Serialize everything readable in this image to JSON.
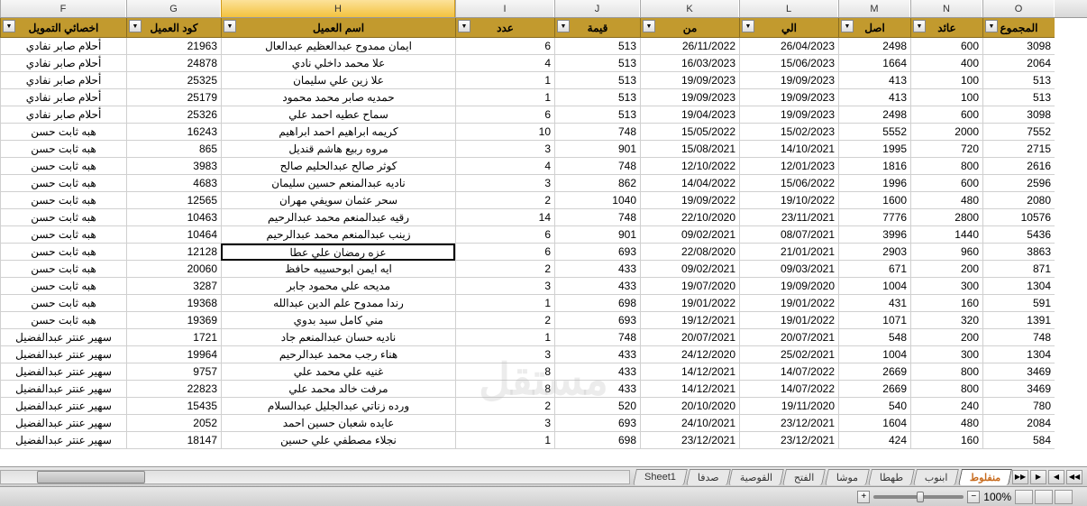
{
  "columns": [
    {
      "id": "F",
      "width": "c-F"
    },
    {
      "id": "G",
      "width": "c-G"
    },
    {
      "id": "H",
      "width": "c-H"
    },
    {
      "id": "I",
      "width": "c-I"
    },
    {
      "id": "J",
      "width": "c-J"
    },
    {
      "id": "K",
      "width": "c-K"
    },
    {
      "id": "L",
      "width": "c-L"
    },
    {
      "id": "M",
      "width": "c-M"
    },
    {
      "id": "N",
      "width": "c-N"
    },
    {
      "id": "O",
      "width": "c-O"
    }
  ],
  "selected_column": "H",
  "selected_row_index": 12,
  "headers": {
    "F": "اخصائي التمويل",
    "G": "كود العميل",
    "H": "اسم العميل",
    "I": "عدد",
    "J": "قيمة",
    "K": "من",
    "L": "الي",
    "M": "اصل",
    "N": "عائد",
    "O": "المجموع"
  },
  "rows": [
    {
      "F": "أحلام صابر نفادي",
      "G": "21963",
      "H": "ايمان ممدوح عبدالعظيم عبدالعال",
      "I": "6",
      "J": "513",
      "K": "26/11/2022",
      "L": "26/04/2023",
      "M": "2498",
      "N": "600",
      "O": "3098"
    },
    {
      "F": "أحلام صابر نفادي",
      "G": "24878",
      "H": "علا محمد داخلي نادي",
      "I": "4",
      "J": "513",
      "K": "16/03/2023",
      "L": "15/06/2023",
      "M": "1664",
      "N": "400",
      "O": "2064"
    },
    {
      "F": "أحلام صابر نفادي",
      "G": "25325",
      "H": "علا زين علي سليمان",
      "I": "1",
      "J": "513",
      "K": "19/09/2023",
      "L": "19/09/2023",
      "M": "413",
      "N": "100",
      "O": "513"
    },
    {
      "F": "أحلام صابر نفادي",
      "G": "25179",
      "H": "حمديه صابر محمد محمود",
      "I": "1",
      "J": "513",
      "K": "19/09/2023",
      "L": "19/09/2023",
      "M": "413",
      "N": "100",
      "O": "513"
    },
    {
      "F": "أحلام صابر نفادي",
      "G": "25326",
      "H": "سماح عطيه احمد علي",
      "I": "6",
      "J": "513",
      "K": "19/04/2023",
      "L": "19/09/2023",
      "M": "2498",
      "N": "600",
      "O": "3098"
    },
    {
      "F": "هبه ثابت حسن",
      "G": "16243",
      "H": "كريمه ابراهيم احمد ابراهيم",
      "I": "10",
      "J": "748",
      "K": "15/05/2022",
      "L": "15/02/2023",
      "M": "5552",
      "N": "2000",
      "O": "7552"
    },
    {
      "F": "هبه ثابت حسن",
      "G": "865",
      "H": "مروه ربيع هاشم قنديل",
      "I": "3",
      "J": "901",
      "K": "15/08/2021",
      "L": "14/10/2021",
      "M": "1995",
      "N": "720",
      "O": "2715"
    },
    {
      "F": "هبه ثابت حسن",
      "G": "3983",
      "H": "كوثر صالح عبدالحليم صالح",
      "I": "4",
      "J": "748",
      "K": "12/10/2022",
      "L": "12/01/2023",
      "M": "1816",
      "N": "800",
      "O": "2616"
    },
    {
      "F": "هبه ثابت حسن",
      "G": "4683",
      "H": "ناديه عبدالمنعم حسين سليمان",
      "I": "3",
      "J": "862",
      "K": "14/04/2022",
      "L": "15/06/2022",
      "M": "1996",
      "N": "600",
      "O": "2596"
    },
    {
      "F": "هبه ثابت حسن",
      "G": "12565",
      "H": "سحر عثمان سويفي مهران",
      "I": "2",
      "J": "1040",
      "K": "19/09/2022",
      "L": "19/10/2022",
      "M": "1600",
      "N": "480",
      "O": "2080"
    },
    {
      "F": "هبه ثابت حسن",
      "G": "10463",
      "H": "رقيه عبدالمنعم محمد عبدالرحيم",
      "I": "14",
      "J": "748",
      "K": "22/10/2020",
      "L": "23/11/2021",
      "M": "7776",
      "N": "2800",
      "O": "10576"
    },
    {
      "F": "هبه ثابت حسن",
      "G": "10464",
      "H": "زينب عبدالمنعم محمد عبدالرحيم",
      "I": "6",
      "J": "901",
      "K": "09/02/2021",
      "L": "08/07/2021",
      "M": "3996",
      "N": "1440",
      "O": "5436"
    },
    {
      "F": "هبه ثابت حسن",
      "G": "12128",
      "H": "عزه رمضان علي عطا",
      "I": "6",
      "J": "693",
      "K": "22/08/2020",
      "L": "21/01/2021",
      "M": "2903",
      "N": "960",
      "O": "3863"
    },
    {
      "F": "هبه ثابت حسن",
      "G": "20060",
      "H": "ايه ايمن ابوحسيبه حافظ",
      "I": "2",
      "J": "433",
      "K": "09/02/2021",
      "L": "09/03/2021",
      "M": "671",
      "N": "200",
      "O": "871"
    },
    {
      "F": "هبه ثابت حسن",
      "G": "3287",
      "H": "مديحه علي محمود جابر",
      "I": "3",
      "J": "433",
      "K": "19/07/2020",
      "L": "19/09/2020",
      "M": "1004",
      "N": "300",
      "O": "1304"
    },
    {
      "F": "هبه ثابت حسن",
      "G": "19368",
      "H": "رندا ممدوح علم الدين عبدالله",
      "I": "1",
      "J": "698",
      "K": "19/01/2022",
      "L": "19/01/2022",
      "M": "431",
      "N": "160",
      "O": "591"
    },
    {
      "F": "هبه ثابت حسن",
      "G": "19369",
      "H": "مني كامل سيد بدوي",
      "I": "2",
      "J": "693",
      "K": "19/12/2021",
      "L": "19/01/2022",
      "M": "1071",
      "N": "320",
      "O": "1391"
    },
    {
      "F": "سهير عنتر عبدالفضيل",
      "G": "1721",
      "H": "ناديه حسان عبدالمنعم جاد",
      "I": "1",
      "J": "748",
      "K": "20/07/2021",
      "L": "20/07/2021",
      "M": "548",
      "N": "200",
      "O": "748"
    },
    {
      "F": "سهير عنتر عبدالفضيل",
      "G": "19964",
      "H": "هناء رجب محمد عبدالرحيم",
      "I": "3",
      "J": "433",
      "K": "24/12/2020",
      "L": "25/02/2021",
      "M": "1004",
      "N": "300",
      "O": "1304"
    },
    {
      "F": "سهير عنتر عبدالفضيل",
      "G": "9757",
      "H": "غنيه علي محمد علي",
      "I": "8",
      "J": "433",
      "K": "14/12/2021",
      "L": "14/07/2022",
      "M": "2669",
      "N": "800",
      "O": "3469"
    },
    {
      "F": "سهير عنتر عبدالفضيل",
      "G": "22823",
      "H": "مرفت خالد محمد علي",
      "I": "8",
      "J": "433",
      "K": "14/12/2021",
      "L": "14/07/2022",
      "M": "2669",
      "N": "800",
      "O": "3469"
    },
    {
      "F": "سهير عنتر عبدالفضيل",
      "G": "15435",
      "H": "ورده زناتي عبدالجليل عبدالسلام",
      "I": "2",
      "J": "520",
      "K": "20/10/2020",
      "L": "19/11/2020",
      "M": "540",
      "N": "240",
      "O": "780"
    },
    {
      "F": "سهير عنتر عبدالفضيل",
      "G": "2052",
      "H": "عايده شعبان حسين احمد",
      "I": "3",
      "J": "693",
      "K": "24/10/2021",
      "L": "23/12/2021",
      "M": "1604",
      "N": "480",
      "O": "2084"
    },
    {
      "F": "سهير عنتر عبدالفضيل",
      "G": "18147",
      "H": "نجلاء مصطفي علي حسين",
      "I": "1",
      "J": "698",
      "K": "23/12/2021",
      "L": "23/12/2021",
      "M": "424",
      "N": "160",
      "O": "584"
    }
  ],
  "sheet_tabs": [
    {
      "label": "منفلوط",
      "active": true
    },
    {
      "label": "ابنوب",
      "active": false
    },
    {
      "label": "طهطا",
      "active": false
    },
    {
      "label": "موشا",
      "active": false
    },
    {
      "label": "الفتح",
      "active": false
    },
    {
      "label": "القوصية",
      "active": false
    },
    {
      "label": "صدفا",
      "active": false
    },
    {
      "label": "Sheet1",
      "active": false
    }
  ],
  "status": {
    "zoom": "100%",
    "nav": {
      "first": "◀◀",
      "prev": "◀",
      "next": "▶",
      "last": "▶▶"
    }
  },
  "filter_icon": "▼",
  "watermark": "مستقل"
}
